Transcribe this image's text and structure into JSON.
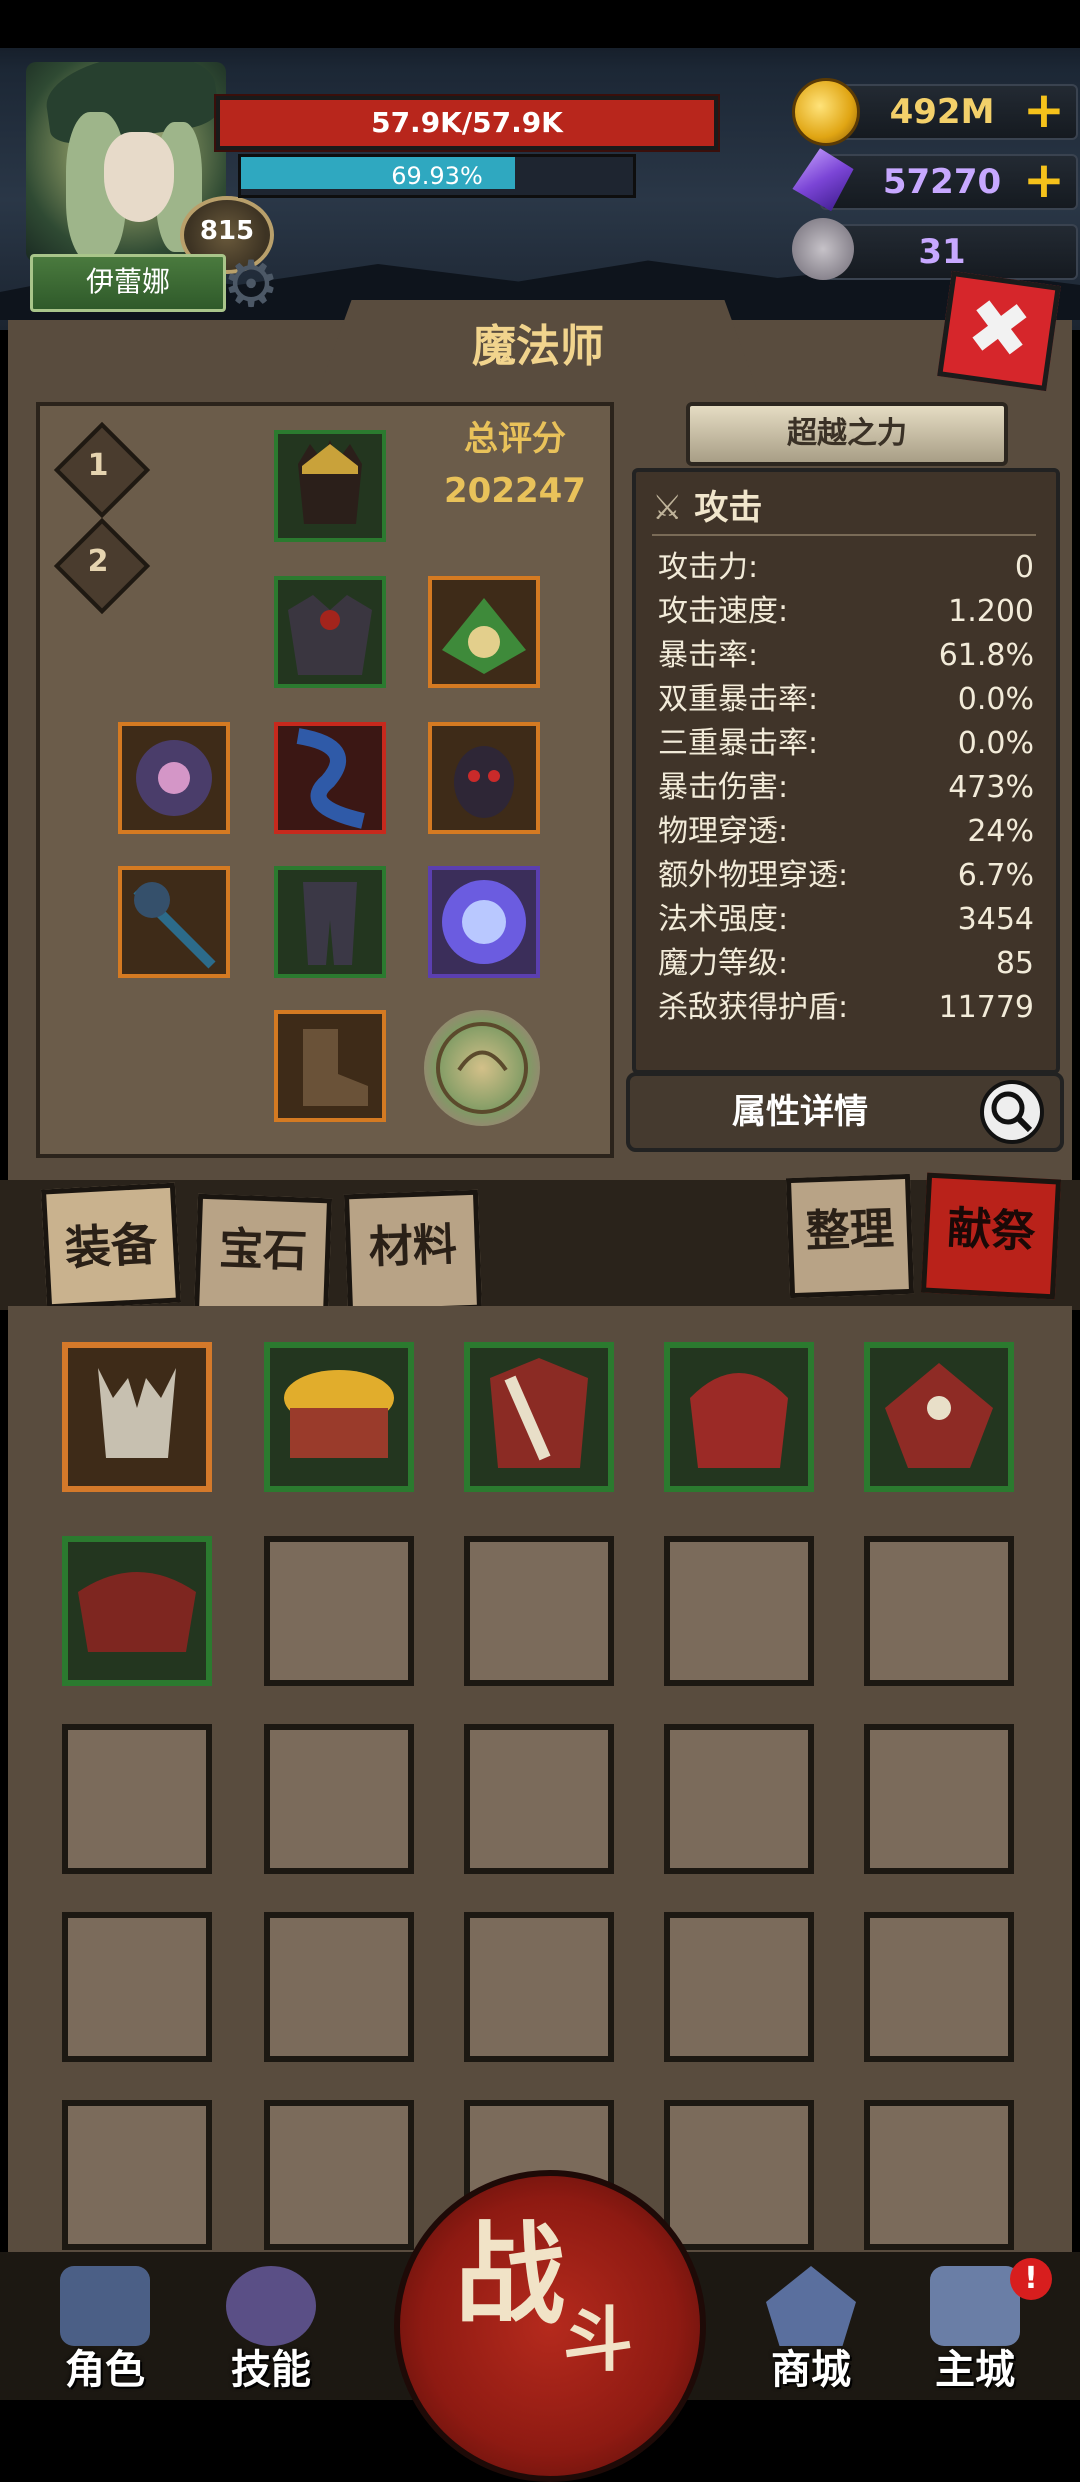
{
  "hero": {
    "name": "伊蕾娜",
    "level": "815",
    "hp_text": "57.9K/57.9K",
    "exp_text": "69.93%",
    "exp_percent": 69.93
  },
  "currency": {
    "gold": "492M",
    "gems": "57270",
    "skulls": "31",
    "plus": "+"
  },
  "panel": {
    "title": "魔法师",
    "close": "✖",
    "page_tabs": [
      "1",
      "2"
    ],
    "score_label": "总评分",
    "score_value": "202247",
    "transcend_label": "超越之力",
    "stat_category": "攻击",
    "stats": [
      {
        "label": "攻击力:",
        "value": "0"
      },
      {
        "label": "攻击速度:",
        "value": "1.200"
      },
      {
        "label": "暴击率:",
        "value": "61.8%"
      },
      {
        "label": "双重暴击率:",
        "value": "0.0%"
      },
      {
        "label": "三重暴击率:",
        "value": "0.0%"
      },
      {
        "label": "暴击伤害:",
        "value": "473%"
      },
      {
        "label": "物理穿透:",
        "value": "24%"
      },
      {
        "label": "额外物理穿透:",
        "value": "6.7%"
      },
      {
        "label": "法术强度:",
        "value": "3454"
      },
      {
        "label": "魔力等级:",
        "value": "85"
      },
      {
        "label": "杀敌获得护盾:",
        "value": "11779"
      }
    ],
    "attr_details": "属性详情"
  },
  "inventory_tabs": {
    "equipment": "装备",
    "gems": "宝石",
    "materials": "材料",
    "sort": "整理",
    "sacrifice": "献祭"
  },
  "nav": {
    "character": "角色",
    "skills": "技能",
    "battle_1": "战",
    "battle_2": "斗",
    "shop": "商城",
    "main_city": "主城",
    "alert": "!"
  },
  "colors": {
    "hp": "#b8261c",
    "exp": "#2fa8c0",
    "gold": "#f5c21b",
    "gem_text": "#c7a8ff",
    "score": "#e9c25a"
  }
}
